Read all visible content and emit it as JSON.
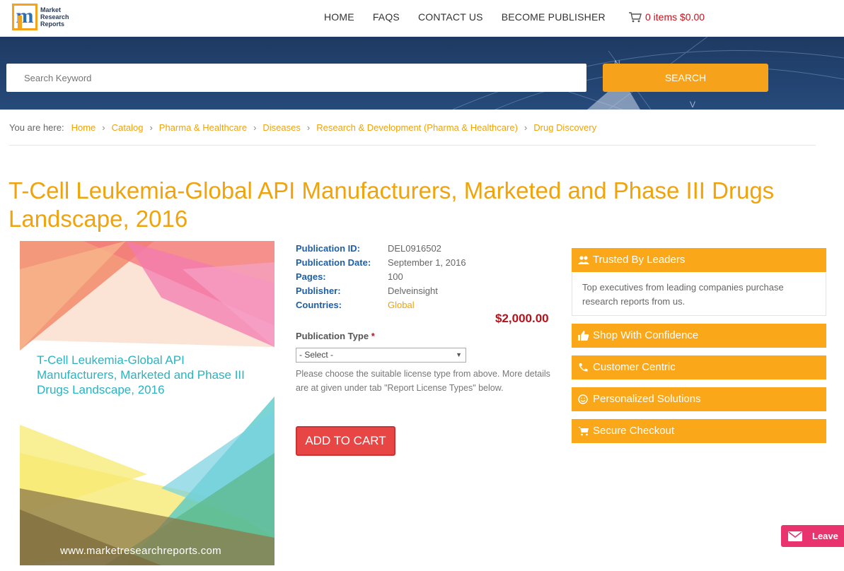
{
  "header": {
    "logo_text": [
      "Market",
      "Research",
      "Reports"
    ],
    "nav": [
      "HOME",
      "FAQS",
      "CONTACT US",
      "BECOME PUBLISHER"
    ],
    "cart_label": "0 items $0.00"
  },
  "search": {
    "placeholder": "Search Keyword",
    "button_label": "SEARCH"
  },
  "breadcrumb": {
    "lead": "You are here:",
    "items": [
      "Home",
      "Catalog",
      "Pharma & Healthcare",
      "Diseases",
      "Research & Development (Pharma & Healthcare)",
      "Drug Discovery"
    ]
  },
  "report": {
    "title": "T-Cell Leukemia-Global API Manufacturers, Marketed and Phase III Drugs Landscape, 2016",
    "cover_title": "T-Cell Leukemia-Global API Manufacturers, Marketed and Phase III Drugs Landscape, 2016",
    "cover_url": "www.marketresearchreports.com",
    "details": [
      {
        "label": "Publication ID:",
        "value": "DEL0916502"
      },
      {
        "label": "Publication Date:",
        "value": "September 1, 2016"
      },
      {
        "label": "Pages:",
        "value": "100"
      },
      {
        "label": "Publisher:",
        "value": "Delveinsight"
      },
      {
        "label": "Countries:",
        "value": "Global"
      }
    ],
    "price": "$2,000.00",
    "publication_type_label": "Publication Type",
    "required_mark": "*",
    "select_value": "- Select -",
    "help_text": "Please choose the suitable license type from above. More details are at given under tab \"Report License Types\" below.",
    "add_to_cart": "ADD TO CART"
  },
  "panels": {
    "trusted_title": "Trusted By Leaders",
    "trusted_body": "Top executives from leading companies purchase research reports from us.",
    "items": [
      "Shop With Confidence",
      "Customer Centric",
      "Personalized Solutions",
      "Secure Checkout"
    ]
  },
  "leave_widget": {
    "label": "Leave"
  },
  "colors": {
    "accent": "#faa719",
    "link": "#f0a30a",
    "price": "#b5121b",
    "cart_button": "#e84545",
    "banner": "#1e3a63"
  }
}
